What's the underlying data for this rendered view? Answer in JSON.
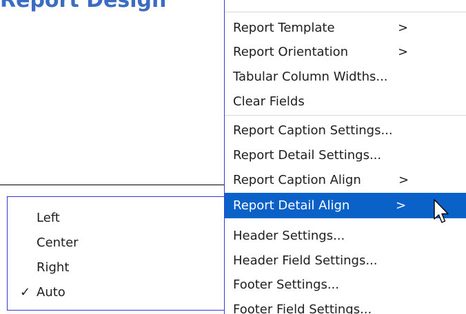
{
  "background": {
    "heading_fragment": "Report Design"
  },
  "main_menu": {
    "items": [
      {
        "label": "Report Template",
        "arrow": ">",
        "highlighted": false
      },
      {
        "label": "Report Orientation",
        "arrow": ">",
        "highlighted": false
      },
      {
        "label": "Tabular Column Widths...",
        "arrow": "",
        "highlighted": false
      },
      {
        "label": "Clear Fields",
        "arrow": "",
        "highlighted": false
      },
      {
        "label": "Report Caption Settings...",
        "arrow": "",
        "highlighted": false
      },
      {
        "label": "Report Detail Settings...",
        "arrow": "",
        "highlighted": false
      },
      {
        "label": "Report Caption Align",
        "arrow": ">",
        "highlighted": false
      },
      {
        "label": "Report Detail Align",
        "arrow": ">",
        "highlighted": true
      },
      {
        "label": "Header Settings...",
        "arrow": "",
        "highlighted": false
      },
      {
        "label": "Header Field Settings...",
        "arrow": "",
        "highlighted": false
      },
      {
        "label": "Footer Settings...",
        "arrow": "",
        "highlighted": false
      },
      {
        "label": "Footer Field Settings...",
        "arrow": "",
        "highlighted": false
      }
    ]
  },
  "sub_menu": {
    "items": [
      {
        "label": "Left",
        "checked": ""
      },
      {
        "label": "Center",
        "checked": ""
      },
      {
        "label": "Right",
        "checked": ""
      },
      {
        "label": "Auto",
        "checked": "✓"
      }
    ]
  },
  "colors": {
    "highlight": "#0a62c9",
    "menu_border": "#3a3ad6",
    "separator": "#d6d6d6",
    "text": "#1e1e1e"
  },
  "icons": {
    "cursor": "mouse-pointer-icon",
    "check": "checkmark-icon"
  }
}
